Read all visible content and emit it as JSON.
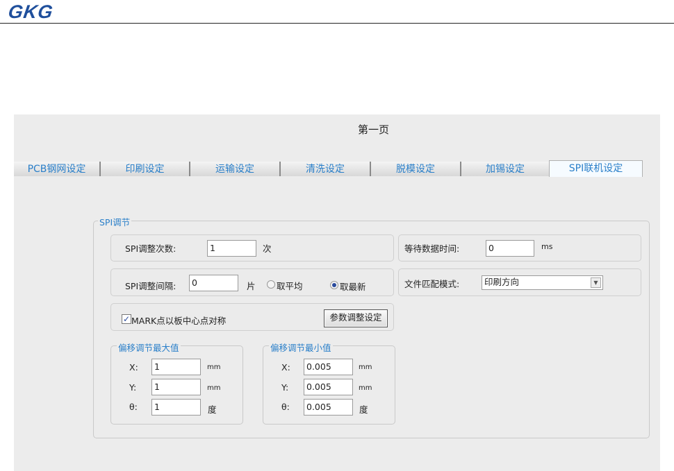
{
  "header": {
    "logo": "GKG"
  },
  "page": {
    "title": "第一页"
  },
  "tabs": [
    "PCB钢网设定",
    "印刷设定",
    "运输设定",
    "清洗设定",
    "脱模设定",
    "加锡设定",
    "SPI联机设定"
  ],
  "spi": {
    "legend": "SPI调节",
    "count_label": "SPI调整次数:",
    "count_value": "1",
    "count_unit": "次",
    "interval_label": "SPI调整间隔:",
    "interval_value": "0",
    "interval_unit": "片",
    "radio_average": "取平均",
    "radio_latest": "取最新",
    "selected_radio": "取最新",
    "mark_checkbox": "MARK点以板中心点对称",
    "mark_checked": true,
    "param_button": "参数调整设定",
    "wait_label": "等待数据时间:",
    "wait_value": "0",
    "wait_unit": "ms",
    "match_label": "文件匹配模式:",
    "match_value": "印刷方向",
    "max": {
      "legend": "偏移调节最大值",
      "x_label": "X:",
      "x": "1",
      "x_unit": "mm",
      "y_label": "Y:",
      "y": "1",
      "y_unit": "mm",
      "t_label": "θ:",
      "t": "1",
      "t_unit": "度"
    },
    "min": {
      "legend": "偏移调节最小值",
      "x_label": "X:",
      "x": "0.005",
      "x_unit": "mm",
      "y_label": "Y:",
      "y": "0.005",
      "y_unit": "mm",
      "t_label": "θ:",
      "t": "0.005",
      "t_unit": "度"
    }
  }
}
